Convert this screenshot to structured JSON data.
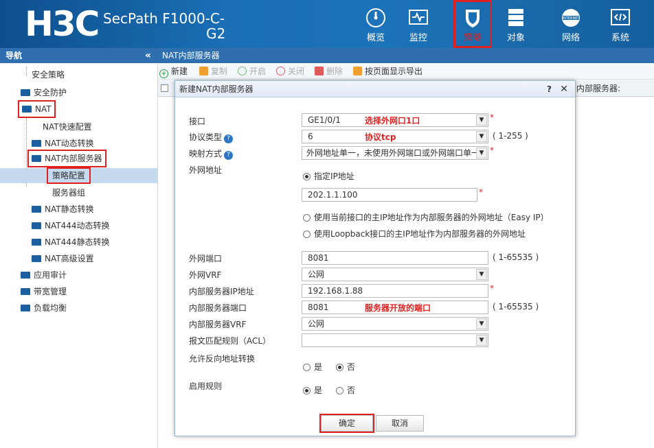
{
  "header": {
    "logo": "H3C",
    "product_line1": "SecPath F1000-C-",
    "product_line2": "G2",
    "nav": [
      {
        "label": "概览",
        "icon": "dashboard-icon"
      },
      {
        "label": "监控",
        "icon": "monitor-icon"
      },
      {
        "label": "策略",
        "icon": "shield-icon"
      },
      {
        "label": "对象",
        "icon": "server-icon"
      },
      {
        "label": "网络",
        "icon": "internet-icon"
      },
      {
        "label": "系统",
        "icon": "code-icon"
      }
    ]
  },
  "sidebar": {
    "title": "导航",
    "collapse": "«",
    "items": [
      {
        "label": "安全策略"
      },
      {
        "label": "安全防护"
      },
      {
        "label": "NAT"
      },
      {
        "label": "NAT快速配置"
      },
      {
        "label": "NAT动态转换"
      },
      {
        "label": "NAT内部服务器"
      },
      {
        "label": "策略配置"
      },
      {
        "label": "服务器组"
      },
      {
        "label": "NAT静态转换"
      },
      {
        "label": "NAT444动态转换"
      },
      {
        "label": "NAT444静态转换"
      },
      {
        "label": "NAT高级设置"
      },
      {
        "label": "应用审计"
      },
      {
        "label": "带宽管理"
      },
      {
        "label": "负载均衡"
      }
    ]
  },
  "tab": {
    "title": "NAT内部服务器"
  },
  "toolbar": {
    "new": "新建",
    "copy": "复制",
    "enable": "开启",
    "disable": "关闭",
    "delete": "删除",
    "export": "按页面显示导出"
  },
  "grid": {
    "column": "内部服务器:"
  },
  "dialog": {
    "title": "新建NAT内部服务器",
    "help": "?",
    "close": "✕",
    "fields": {
      "interface": {
        "label": "接口",
        "value": "GE1/0/1",
        "note": "选择外网口1口"
      },
      "protocol": {
        "label": "协议类型",
        "value": "6",
        "note": "协议tcp",
        "range": "( 1-255 )"
      },
      "mapping": {
        "label": "映射方式",
        "value": "外网地址单一，未使用外网端口或外网端口单一"
      },
      "ext_addr": {
        "label": "外网地址",
        "opt1": "指定IP地址",
        "ip": "202.1.1.100",
        "opt2": "使用当前接口的主IP地址作为内部服务器的外网地址（Easy IP）",
        "opt3": "使用Loopback接口的主IP地址作为内部服务器的外网地址"
      },
      "ext_port": {
        "label": "外网端口",
        "value": "8081",
        "range": "( 1-65535 )"
      },
      "ext_vrf": {
        "label": "外网VRF",
        "value": "公网"
      },
      "int_ip": {
        "label": "内部服务器IP地址",
        "value": "192.168.1.88"
      },
      "int_port": {
        "label": "内部服务器端口",
        "value": "8081",
        "note": "服务器开放的端口",
        "range": "( 1-65535 )"
      },
      "int_vrf": {
        "label": "内部服务器VRF",
        "value": "公网"
      },
      "acl": {
        "label": "报文匹配规则（ACL）",
        "value": ""
      },
      "reverse": {
        "label": "允许反向地址转换",
        "yes": "是",
        "no": "否"
      },
      "enable": {
        "label": "启用规则",
        "yes": "是",
        "no": "否"
      }
    },
    "ok": "确定",
    "cancel": "取消"
  },
  "colors": {
    "accent": "#2f6fb0",
    "highlight": "#e02020"
  }
}
